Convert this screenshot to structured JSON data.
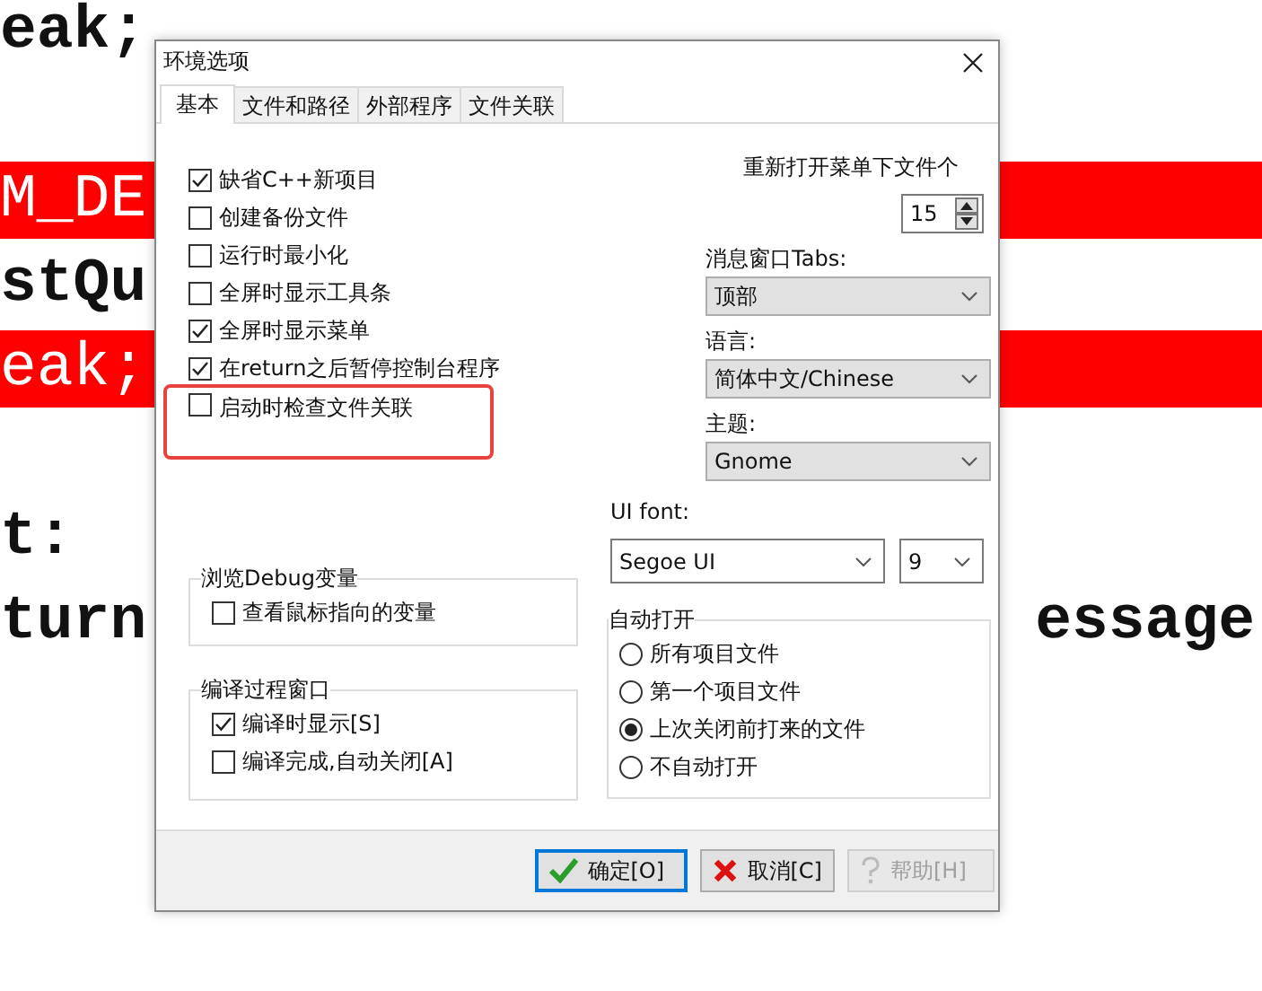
{
  "background_code": {
    "lines": [
      {
        "text": "eak;",
        "highlighted": false,
        "blank_before": false
      },
      {
        "text": "M_DE",
        "highlighted": true,
        "blank_before": true
      },
      {
        "text": "stQu",
        "highlighted": false,
        "blank_before": false
      },
      {
        "text": "eak;",
        "highlighted": true,
        "blank_before": false
      },
      {
        "text": "t:",
        "highlighted": false,
        "blank_before": true
      },
      {
        "text": "turn",
        "highlighted": false,
        "blank_before": false,
        "trailing_text": "essage"
      }
    ]
  },
  "dialog": {
    "title": "环境选项",
    "tabs": [
      {
        "label": "基本",
        "selected": true
      },
      {
        "label": "文件和路径",
        "selected": false
      },
      {
        "label": "外部程序",
        "selected": false
      },
      {
        "label": "文件关联",
        "selected": false
      }
    ],
    "options": [
      {
        "label": "缺省C++新项目",
        "checked": true,
        "highlighted": false
      },
      {
        "label": "创建备份文件",
        "checked": false,
        "highlighted": false
      },
      {
        "label": "运行时最小化",
        "checked": false,
        "highlighted": false
      },
      {
        "label": "全屏时显示工具条",
        "checked": false,
        "highlighted": false
      },
      {
        "label": "全屏时显示菜单",
        "checked": true,
        "highlighted": false
      },
      {
        "label": "在return之后暂停控制台程序",
        "checked": true,
        "highlighted": false
      },
      {
        "label": "启动时检查文件关联",
        "checked": false,
        "highlighted": true
      }
    ],
    "recent_files": {
      "label": "重新打开菜单下文件个",
      "value": "15"
    },
    "selects": [
      {
        "label": "消息窗口Tabs:",
        "value": "顶部"
      },
      {
        "label": "语言:",
        "value": "简体中文/Chinese"
      },
      {
        "label": "主题:",
        "value": "Gnome"
      }
    ],
    "ui_font": {
      "label": "UI font:",
      "font": "Segoe UI",
      "size": "9"
    },
    "debug_group": {
      "title": "浏览Debug变量",
      "options": [
        {
          "label": "查看鼠标指向的变量",
          "checked": false
        }
      ]
    },
    "compile_group": {
      "title": "编译过程窗口",
      "options": [
        {
          "label": "编译时显示[S]",
          "checked": true
        },
        {
          "label": "编译完成,自动关闭[A]",
          "checked": false
        }
      ]
    },
    "auto_open": {
      "title": "自动打开",
      "options": [
        {
          "label": "所有项目文件",
          "selected": false
        },
        {
          "label": "第一个项目文件",
          "selected": false
        },
        {
          "label": "上次关闭前打来的文件",
          "selected": true
        },
        {
          "label": "不自动打开",
          "selected": false
        }
      ]
    },
    "buttons": [
      {
        "label": "确定[O]",
        "kind": "ok",
        "default": true,
        "disabled": false
      },
      {
        "label": "取消[C]",
        "kind": "cancel",
        "default": false,
        "disabled": false
      },
      {
        "label": "帮助[H]",
        "kind": "help",
        "default": false,
        "disabled": true
      }
    ]
  }
}
